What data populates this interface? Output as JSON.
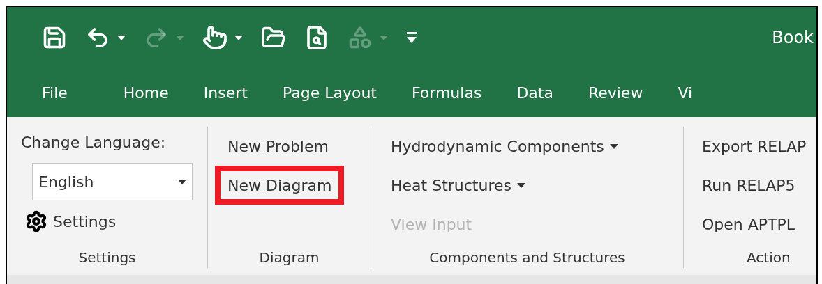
{
  "quick_access": [
    {
      "kind": "save",
      "disabled": false,
      "dropdown": false
    },
    {
      "kind": "undo",
      "disabled": false,
      "dropdown": true
    },
    {
      "kind": "redo",
      "disabled": true,
      "dropdown": true
    },
    {
      "kind": "touch",
      "disabled": false,
      "dropdown": true
    },
    {
      "kind": "open",
      "disabled": false,
      "dropdown": false
    },
    {
      "kind": "preview",
      "disabled": false,
      "dropdown": false
    },
    {
      "kind": "shapes",
      "disabled": true,
      "dropdown": true
    },
    {
      "kind": "customize",
      "disabled": false,
      "dropdown": false
    }
  ],
  "window": {
    "title": "Book"
  },
  "tabs": [
    {
      "label": "File"
    },
    {
      "label": "Home"
    },
    {
      "label": "Insert"
    },
    {
      "label": "Page Layout"
    },
    {
      "label": "Formulas"
    },
    {
      "label": "Data"
    },
    {
      "label": "Review"
    },
    {
      "label": "Vi"
    }
  ],
  "settings_group": {
    "language_label": "Change Language:",
    "language_select": {
      "value": "English"
    },
    "settings_button": "Settings",
    "group_label": "Settings"
  },
  "groups": [
    {
      "label": "Diagram",
      "items": [
        {
          "label": "New Problem",
          "disabled": false,
          "dropdown": false,
          "highlighted": false
        },
        {
          "label": "New Diagram",
          "disabled": false,
          "dropdown": false,
          "highlighted": true
        }
      ]
    },
    {
      "label": "Components and Structures",
      "items": [
        {
          "label": "Hydrodynamic Components",
          "disabled": false,
          "dropdown": true,
          "highlighted": false
        },
        {
          "label": "Heat Structures",
          "disabled": false,
          "dropdown": true,
          "highlighted": false
        },
        {
          "label": "View Input",
          "disabled": true,
          "dropdown": false,
          "highlighted": false
        }
      ]
    },
    {
      "label": "Action",
      "items": [
        {
          "label": "Export RELAP",
          "disabled": false,
          "dropdown": false,
          "highlighted": false
        },
        {
          "label": "Run RELAP5",
          "disabled": false,
          "dropdown": false,
          "highlighted": false
        },
        {
          "label": "Open APTPL",
          "disabled": false,
          "dropdown": false,
          "highlighted": false
        }
      ]
    }
  ]
}
